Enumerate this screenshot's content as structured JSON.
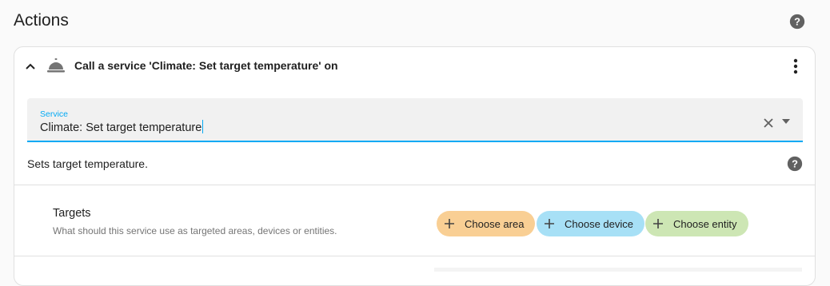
{
  "header": {
    "title": "Actions",
    "help_icon": "help-circle-icon"
  },
  "action_card": {
    "title": "Call a service 'Climate: Set target temperature' on",
    "expanded": true,
    "icon": "concierge-bell-icon",
    "menu_icon": "dots-vertical-icon",
    "service_field": {
      "label": "Service",
      "value": "Climate: Set target temperature",
      "accent_color": "#03a9f4"
    },
    "description": "Sets target temperature.",
    "targets": {
      "title": "Targets",
      "description": "What should this service use as targeted areas, devices or entities.",
      "chips": [
        {
          "label": "Choose area",
          "color": "#f9cf94"
        },
        {
          "label": "Choose device",
          "color": "#a7e0f6"
        },
        {
          "label": "Choose entity",
          "color": "#cde6b4"
        }
      ]
    }
  }
}
